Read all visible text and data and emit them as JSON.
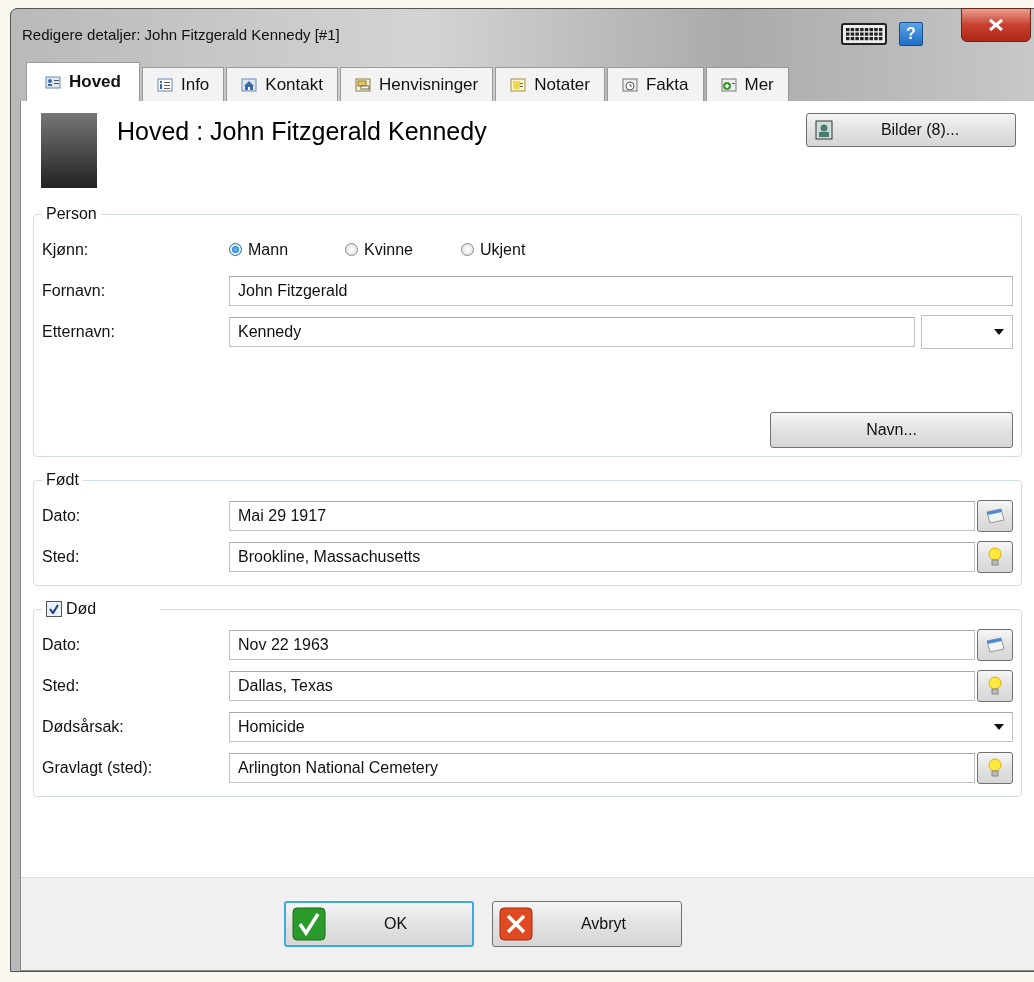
{
  "window": {
    "title": "Redigere detaljer: John Fitzgerald Kennedy [#1]",
    "help_button": "?"
  },
  "tabs": [
    {
      "label": "Hoved",
      "selected": true
    },
    {
      "label": "Info",
      "selected": false
    },
    {
      "label": "Kontakt",
      "selected": false
    },
    {
      "label": "Henvisninger",
      "selected": false
    },
    {
      "label": "Notater",
      "selected": false
    },
    {
      "label": "Fakta",
      "selected": false
    },
    {
      "label": "Mer",
      "selected": false
    }
  ],
  "header": {
    "title": "Hoved : John Fitzgerald Kennedy",
    "pictures_button": "Bilder (8)..."
  },
  "person": {
    "legend": "Person",
    "gender_label": "Kjønn:",
    "gender_options": [
      {
        "label": "Mann",
        "selected": true
      },
      {
        "label": "Kvinne",
        "selected": false
      },
      {
        "label": "Ukjent",
        "selected": false
      }
    ],
    "fields": [
      {
        "kind": "text",
        "label": "Fornavn:",
        "value": "John Fitzgerald"
      },
      {
        "kind": "text-suffix",
        "label": "Etternavn:",
        "value": "Kennedy"
      }
    ],
    "names_button": "Navn..."
  },
  "born": {
    "legend": "Født",
    "fields": [
      {
        "kind": "date",
        "label": "Dato:",
        "value": "Mai 29 1917"
      },
      {
        "kind": "place",
        "label": "Sted:",
        "value": "Brookline, Massachusetts"
      }
    ]
  },
  "died": {
    "legend": "Død",
    "checked": true,
    "fields": [
      {
        "kind": "date",
        "label": "Dato:",
        "value": "Nov 22 1963"
      },
      {
        "kind": "place",
        "label": "Sted:",
        "value": "Dallas, Texas"
      },
      {
        "kind": "dropdown",
        "label": "Dødsårsak:",
        "value": "Homicide"
      },
      {
        "kind": "place",
        "label": "Gravlagt (sted):",
        "value": "Arlington National Cemetery"
      }
    ]
  },
  "buttons": [
    {
      "kind": "ok",
      "label": "OK"
    },
    {
      "kind": "cancel",
      "label": "Avbryt"
    }
  ]
}
